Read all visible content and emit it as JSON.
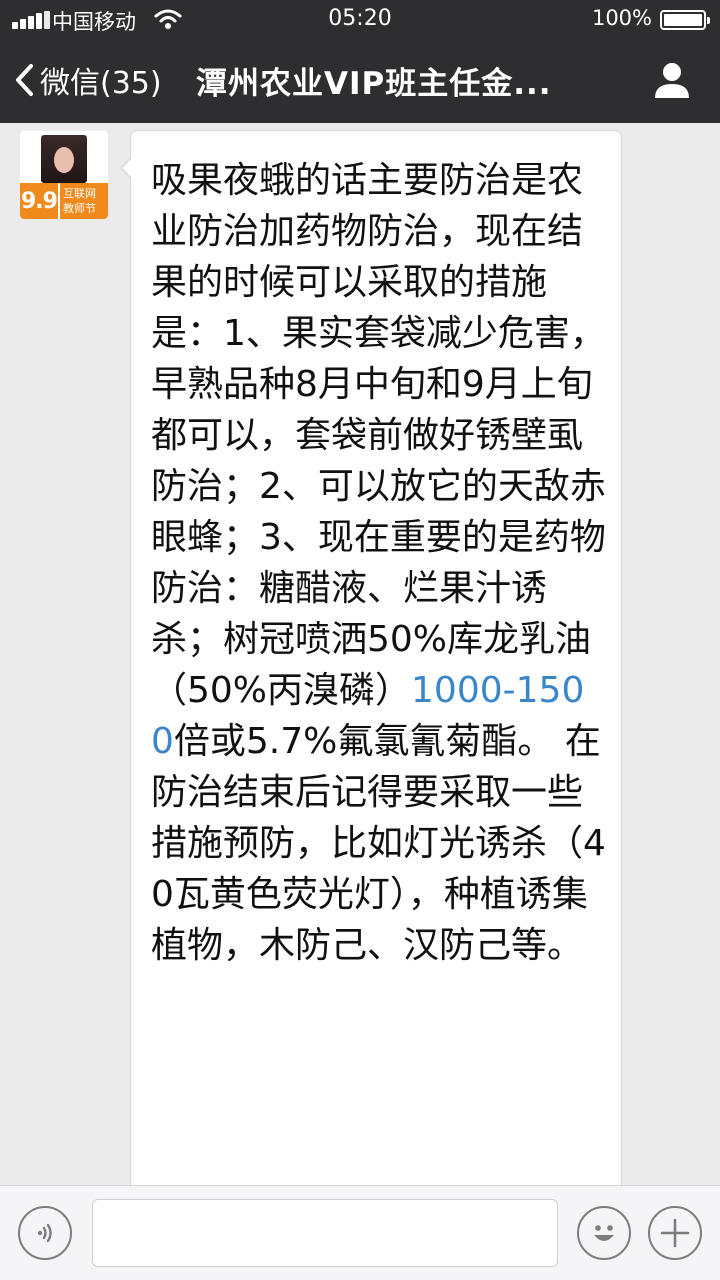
{
  "status_bar": {
    "carrier": "中国移动",
    "time": "05:20",
    "battery_percent": "100%"
  },
  "nav": {
    "back_label": "微信(35)",
    "title": "潭州农业VIP班主任金..."
  },
  "message": {
    "part1": "吸果夜蛾的话主要防治是农业防治加药物防治，现在结果的时候可以采取的措施是：1、果实套袋减少危害，早熟品种8月中旬和9月上旬都可以，套袋前做好锈壁虱防治；2、可以放它的天敌赤眼蜂；3、现在重要的是药物防治：糖醋液、烂果汁诱杀；树冠喷洒50%库龙乳油（50%丙溴磷）",
    "link": "1000-1500",
    "part2": "倍或5.7%氟氯氰菊酯。 在防治结束后记得要采取一些措施预防，比如灯光诱杀（40瓦黄色荧光灯），种植诱集植物，木防己、汉防己等。"
  },
  "avatar_badge": {
    "number": "9.9",
    "line1": "互联网",
    "line2": "教师节"
  },
  "input_bar": {
    "placeholder": ""
  }
}
